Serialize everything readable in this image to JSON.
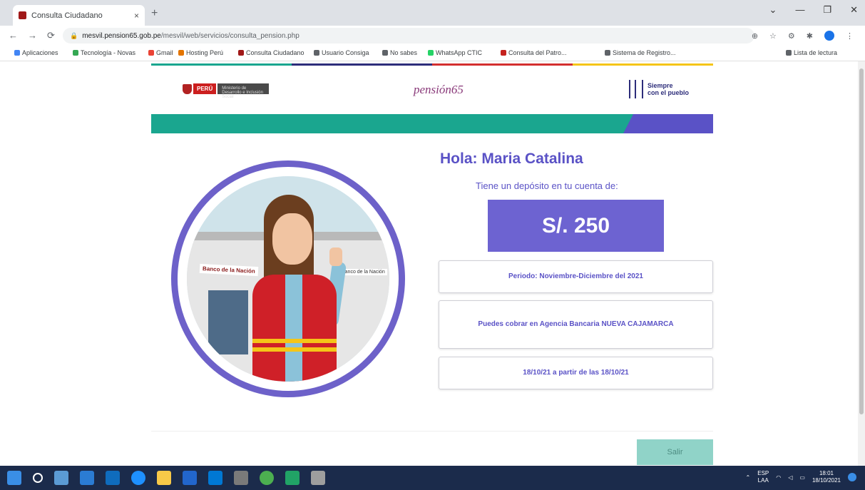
{
  "browser": {
    "tab_title": "Consulta Ciudadano",
    "tab_close": "×",
    "new_tab": "+",
    "window_controls": [
      "⌄",
      "—",
      "❐",
      "✕"
    ],
    "url_host": "mesvil.pension65.gob.pe",
    "url_path": "/mesvil/web/servicios/consulta_pension.php",
    "nav": [
      "←",
      "→",
      "⟳"
    ],
    "bookmarks": [
      {
        "label": "Aplicaciones",
        "color": "#4285f4"
      },
      {
        "label": "Tecnología - Novas",
        "color": "#34a853"
      },
      {
        "label": "Gmail",
        "color": "#ea4335"
      },
      {
        "label": "Hosting Perú",
        "color": "#e37400"
      },
      {
        "label": "Consulta Ciudadano",
        "color": "#a01818"
      },
      {
        "label": "Usuario Consiga",
        "color": "#5f6368"
      },
      {
        "label": "No sabes",
        "color": "#5f6368"
      },
      {
        "label": "WhatsApp CTIC",
        "color": "#25d366"
      },
      {
        "label": "Consulta del Patro...",
        "color": "#c5221f"
      },
      {
        "label": "Sistema de Registro...",
        "color": "#5f6368"
      }
    ],
    "reading_list": "Lista de lectura"
  },
  "header": {
    "gov_label": "PERÚ",
    "ministry_label": "Ministerio de Desarrollo e Inclusión Social",
    "pension_logo": "pensión65",
    "siempre_logo_line1": "Siempre",
    "siempre_logo_line2": "con el pueblo"
  },
  "stripe_colors": [
    "#1aa68f",
    "#2d2d7a",
    "#d32f2f",
    "#f5c518"
  ],
  "illustration": {
    "sign_left": "Banco de la Nación",
    "sign_right": "Banco de la Nación"
  },
  "main": {
    "greeting": "Hola: Maria Catalina",
    "deposit_label": "Tiene un depósito en tu cuenta de:",
    "amount": "S/. 250",
    "period": "Periodo: Noviembre-Diciembre del 2021",
    "agency": "Puedes cobrar en Agencia Bancaria NUEVA CAJAMARCA",
    "date_info": "18/10/21 a partir de las 18/10/21",
    "exit_button": "Salir"
  },
  "colors": {
    "teal": "#1aa68f",
    "purple": "#5a52c6",
    "amount_bg": "#6d63d1"
  },
  "taskbar": {
    "lang": "ESP",
    "lang2": "LAA",
    "time": "18:01",
    "date": "18/10/2021"
  }
}
